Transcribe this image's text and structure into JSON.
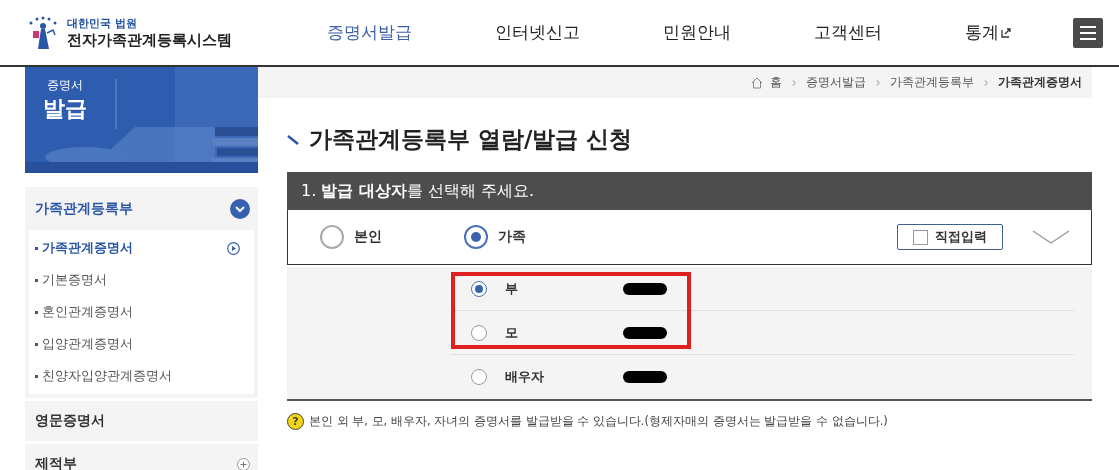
{
  "header": {
    "logo_small": "대한민국 법원",
    "logo_title": "전자가족관계등록시스템",
    "nav": [
      {
        "label": "증명서발급",
        "selected": true,
        "external": false
      },
      {
        "label": "인터넷신고",
        "selected": false,
        "external": false
      },
      {
        "label": "민원안내",
        "selected": false,
        "external": false
      },
      {
        "label": "고객센터",
        "selected": false,
        "external": false
      },
      {
        "label": "통계",
        "selected": false,
        "external": true
      }
    ]
  },
  "banner": {
    "kind": "picture",
    "title_top": "증명서",
    "title_bottom": "발급"
  },
  "sidebar": {
    "groups": [
      {
        "label": "가족관계등록부",
        "expanded": true,
        "children": [
          {
            "label": "가족관계증명서",
            "selected": true
          },
          {
            "label": "기본증명서",
            "selected": false
          },
          {
            "label": "혼인관계증명서",
            "selected": false
          },
          {
            "label": "입양관계증명서",
            "selected": false
          },
          {
            "label": "친양자입양관계증명서",
            "selected": false
          }
        ]
      },
      {
        "label": "영문증명서",
        "expanded": false,
        "expandable": false
      },
      {
        "label": "제적부",
        "expanded": false,
        "expandable": true
      }
    ]
  },
  "breadcrumb": [
    "홈",
    "증명서발급",
    "가족관계등록부",
    "가족관계증명서"
  ],
  "title": "가족관계등록부 열람/발급 신청",
  "step": {
    "heading": "1. **발급 대상자**를 선택해 주세요.",
    "targets": [
      {
        "label": "본인",
        "selected": false
      },
      {
        "label": "가족",
        "selected": true
      }
    ],
    "direct_input": {
      "label": "직접입력",
      "checked": false
    },
    "expanded": true,
    "family": [
      {
        "label": "부",
        "selected": true,
        "redacted": true,
        "highlighted": true
      },
      {
        "label": "모",
        "selected": false,
        "redacted": true,
        "highlighted": true
      },
      {
        "label": "배우자",
        "selected": false,
        "redacted": true,
        "highlighted": false
      }
    ]
  },
  "note_mark": "?",
  "note": "본인 외 부, 모, 배우자, 자녀의 증명서를 발급받을 수 있습니다.(형제자매의 증명서는 발급받을 수 없습니다.)"
}
